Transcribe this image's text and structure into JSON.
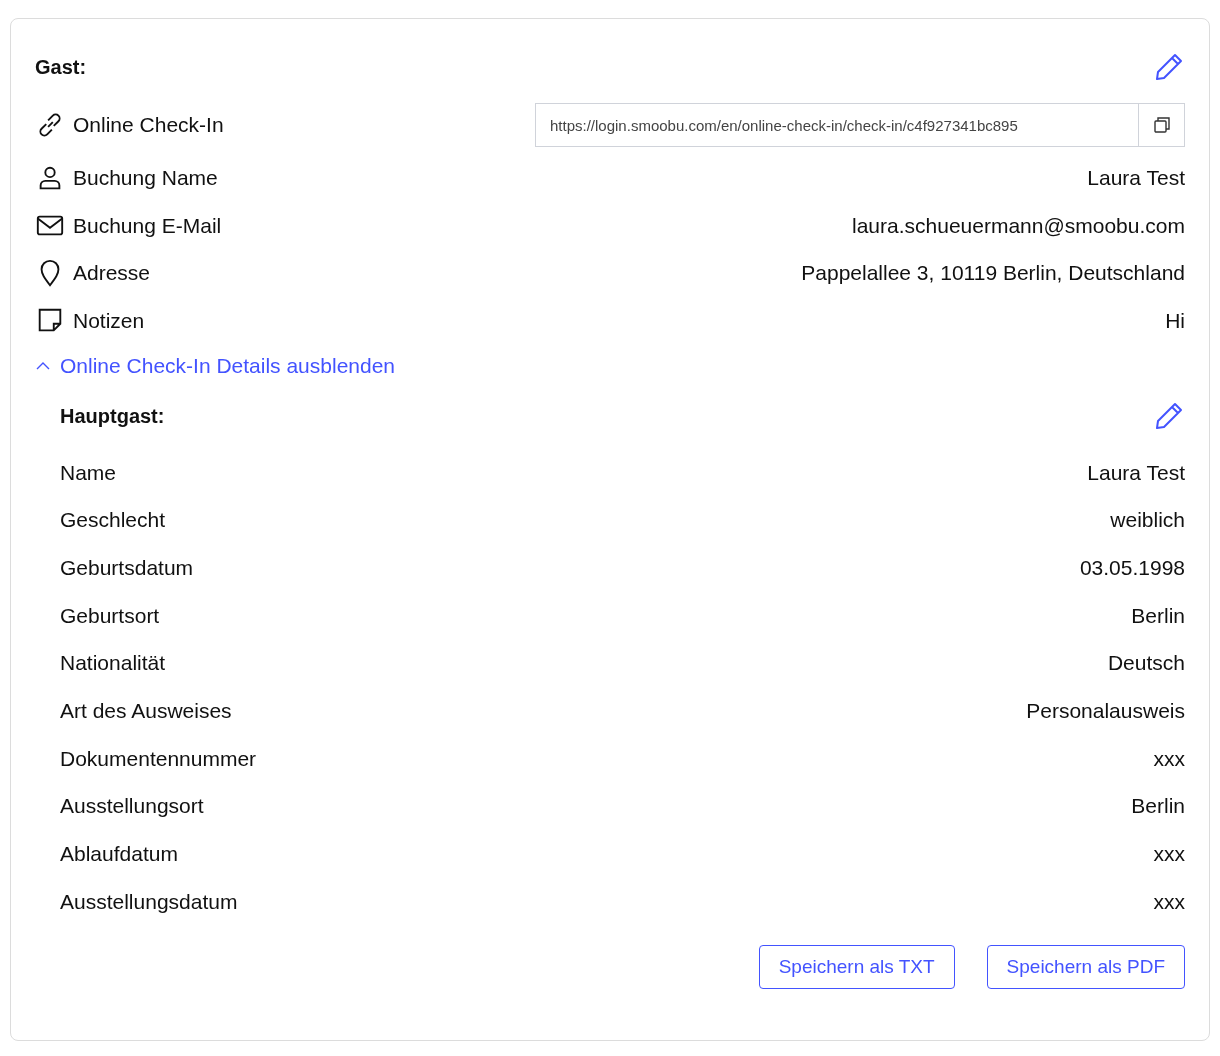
{
  "guest": {
    "title": "Gast:",
    "rows": [
      {
        "kind": "link",
        "label": "Online Check-In",
        "url": "https://login.smoobu.com/en/online-check-in/check-in/c4f927341bc895"
      },
      {
        "kind": "person",
        "label": "Buchung Name",
        "value": "Laura Test"
      },
      {
        "kind": "mail",
        "label": "Buchung E-Mail",
        "value": "laura.schueuermann@smoobu.com"
      },
      {
        "kind": "pin",
        "label": "Adresse",
        "value": "Pappelallee 3, 10119 Berlin, Deutschland"
      },
      {
        "kind": "note",
        "label": "Notizen",
        "value": "Hi"
      }
    ]
  },
  "details_toggle": {
    "label": "Online Check-In Details ausblenden",
    "expanded": true
  },
  "main_guest": {
    "title": "Hauptgast:",
    "rows": [
      {
        "label": "Name",
        "value": "Laura Test"
      },
      {
        "label": "Geschlecht",
        "value": "weiblich"
      },
      {
        "label": "Geburtsdatum",
        "value": "03.05.1998"
      },
      {
        "label": "Geburtsort",
        "value": "Berlin"
      },
      {
        "label": "Nationalität",
        "value": "Deutsch"
      },
      {
        "label": "Art des Ausweises",
        "value": "Personalausweis"
      },
      {
        "label": "Dokumentennummer",
        "value": "xxx"
      },
      {
        "label": "Ausstellungsort",
        "value": "Berlin"
      },
      {
        "label": "Ablaufdatum",
        "value": "xxx"
      },
      {
        "label": "Ausstellungsdatum",
        "value": "xxx"
      }
    ]
  },
  "buttons": [
    "Speichern als TXT",
    "Speichern als PDF"
  ]
}
